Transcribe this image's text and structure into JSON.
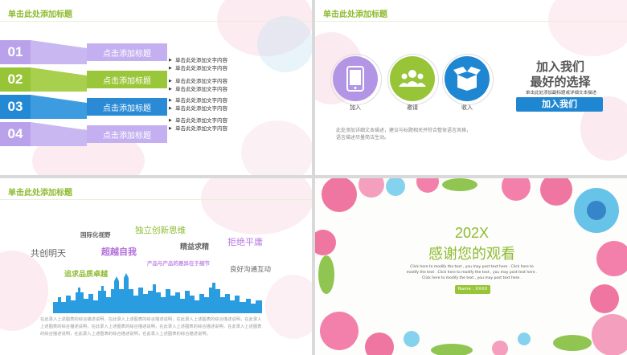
{
  "colors": {
    "purple": "#b8a3e8",
    "green": "#98c437",
    "blue": "#2a8ad6",
    "title_green": "#8dbb30"
  },
  "slide1": {
    "title": "单击此处添加标题",
    "rows": [
      {
        "num": "01",
        "label": "点击添加标题",
        "desc": [
          "单击此处添加文字内容",
          "单击此处添加文字内容"
        ]
      },
      {
        "num": "02",
        "label": "点击添加标题",
        "desc": [
          "单击此处添加文字内容",
          "单击此处添加文字内容"
        ]
      },
      {
        "num": "03",
        "label": "点击添加标题",
        "desc": [
          "单击此处添加文字内容",
          "单击此处添加文字内容"
        ]
      },
      {
        "num": "04",
        "label": "点击添加标题",
        "desc": [
          "单击此处添加文字内容",
          "单击此处添加文字内容"
        ]
      }
    ]
  },
  "slide2": {
    "title": "单击此处添加标题",
    "icons": [
      {
        "icon": "phone-icon",
        "label": "加入"
      },
      {
        "icon": "people-icon",
        "label": "邀请"
      },
      {
        "icon": "box-icon",
        "label": "收入"
      }
    ],
    "headline1": "加入我们",
    "headline2": "最好的选择",
    "subtitle": "单击此处添加副标题或详细文本描述",
    "button": "加入我们",
    "body1": "此处添加详细文本描述，建议与标题相关并符合整体语言风格，",
    "body2": "语言描述尽量简洁生动。"
  },
  "slide3": {
    "title": "单击此处添加标题",
    "words": {
      "w1": "国际化视野",
      "w2": "独立创新思维",
      "w3": "共创明天",
      "w4": "超越自我",
      "w5": "精益求精",
      "w6": "拒绝平庸",
      "w7": "产品与产品的差异在于细节",
      "w8": "追求品质卓越",
      "w9": "良好沟通互动"
    },
    "paragraph": [
      "在此录入上述图表的综合描述说明，在此录入上述图表的综合描述说明，在此录入上述图表的综合描述说明，在此录入",
      "上述图表的综合描述说明，在此录入上述图表的综合描述说明，在此录入上述图表的综合描述说明，在此录入上述图表",
      "的综合描述说明，在此录入上述图表的综合描述说明，在此录入上述图表的综合描述说明。"
    ]
  },
  "slide4": {
    "year": "202X",
    "thanks": "感谢您的观看",
    "small": [
      "Click here to modify the text , you may post text here . Click here to",
      "modify the text . Click here to modify the text , you may post text here .",
      "Click here to modify the text , you may post text here ."
    ],
    "name": "Name : XXXX"
  }
}
